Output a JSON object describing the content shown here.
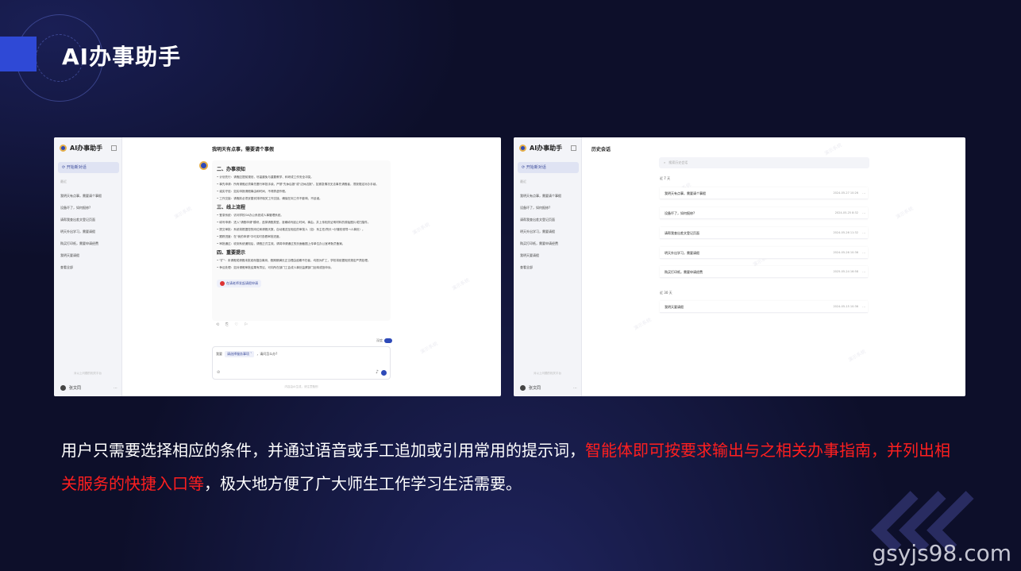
{
  "header": {
    "title": "AI办事助手"
  },
  "left_app": {
    "logo_text": "AI办事助手",
    "new_chat": "开始新对话",
    "recent_label": "最近",
    "history": [
      "我明天有点事，需要请个事假",
      "设备坏了，如何报修?",
      "请帮我查出差文登记页面",
      "明天外出学习，需要请假",
      "购买打印纸，需要申请经费",
      "我明天要请假"
    ],
    "view_all": "查看全部",
    "footer_note": "对以上问题的相关平台",
    "user_name": "张文同",
    "chat_title": "我明天有点事，需要请个事假",
    "message": {
      "h1": "二、办事须知",
      "p1": "• 计划先行：请假应提前规划，尽量避免与重要教学、科研或工作安全冲突。",
      "p2": "• 事先申请：所有请假必须事先履行审批手续，严禁\"先休后报\"或\"边休边报\"。如紧急情况无法事先请假者，须按规定补办手续。",
      "p3": "• 诚实守信：如实申报请假事由和时间，不得弄虚作假。",
      "p4": "• 工作交接：请假前必须妥善安排好相关工作交接，确保在岗工作不影响、不延误。",
      "h2": "三、线上流程",
      "p5": "• 登录系统：访问学校OA办公系统或人事管理系统。",
      "p6": "• 填写申请：进入\"请假申请\"模块，选择请假类型。准确填写起止时间、事由。并上传相关证明材料的原始图片或扫描件。",
      "p7": "• 提交审批：系统将根据您的岗位和请假天数，自动推送至相应的审批人（如：系主任/院长→分管校领导→人事处）。",
      "p8": "• 跟踪进度：在\"我的申请\"中可实时查看审批进度。",
      "p9": "• 审批通过：收到系统通知后，请假正式生效。请将申请通过的页面截图上传单位办公室考勤员备案。",
      "h3": "四、重要提示",
      "p10": "• \"扩\"：未请假或请假未批准而擅自离岗、假期期满无正当理由逾期不归者，均视为旷工，学校将依据相关规定严肃处理。",
      "p11": "• 争议处理：如对请假审批结果有异议，可向所在部门工会或人事处监察部门反映或投申诉。",
      "link": "在请老师发起请假申请"
    },
    "actions": "⟲ ⎘ ♡ ⚐",
    "toggle_label": "深度",
    "input": {
      "prefix": "我要",
      "chip": "请选择服务事项 ˅",
      "suffix": "，请问怎么办?"
    },
    "disclaimer": "内容由AI生成，请注意甄别"
  },
  "right_app": {
    "logo_text": "AI办事助手",
    "new_chat": "开始新对话",
    "recent_label": "最近",
    "history": [
      "我明天有点事，需要请个事假",
      "设备坏了，如何报修?",
      "请帮我查出差文登记页面",
      "明天外出学习，需要请假",
      "购买打印纸，需要申请经费",
      "我明天要请假"
    ],
    "view_all": "查看全部",
    "footer_note": "对以上问题的相关平台",
    "user_name": "张文同",
    "page_title": "历史会话",
    "search_placeholder": "搜索历史会话",
    "group_7": "近 7 天",
    "group_30": "近 30 天",
    "items_7": [
      {
        "title": "我明天有点事，需要请个事假",
        "date": "2024-05-27 10:26"
      },
      {
        "title": "设备坏了，如何报修?",
        "date": "2024-05-25 8:32"
      },
      {
        "title": "请帮我查出差文登记页面",
        "date": "2024-05-26 11:32"
      },
      {
        "title": "明天外出学习，需要请假",
        "date": "2024-05-26 10:36"
      },
      {
        "title": "购买打印纸，需要申请经费",
        "date": "2025-05-24 16:58"
      }
    ],
    "items_30": [
      {
        "title": "我明天要请假",
        "date": "2024-05-15 10:36"
      }
    ]
  },
  "watermark": "演示系统",
  "caption": {
    "part1": "用户只需要选择相应的条件，并通过语音或手工追加或引用常用的提示词，",
    "highlight": "智能体即可按要求输出与之相关办事指南，并列出相关服务的快捷入口等",
    "part2": "，极大地方便了广大师生工作学习生活需要。"
  },
  "site_watermark": "gsyjs98.com",
  "colors": {
    "highlight": "#ff1f1f",
    "accent": "#2e4ab8",
    "background": "#0d0f2a"
  }
}
